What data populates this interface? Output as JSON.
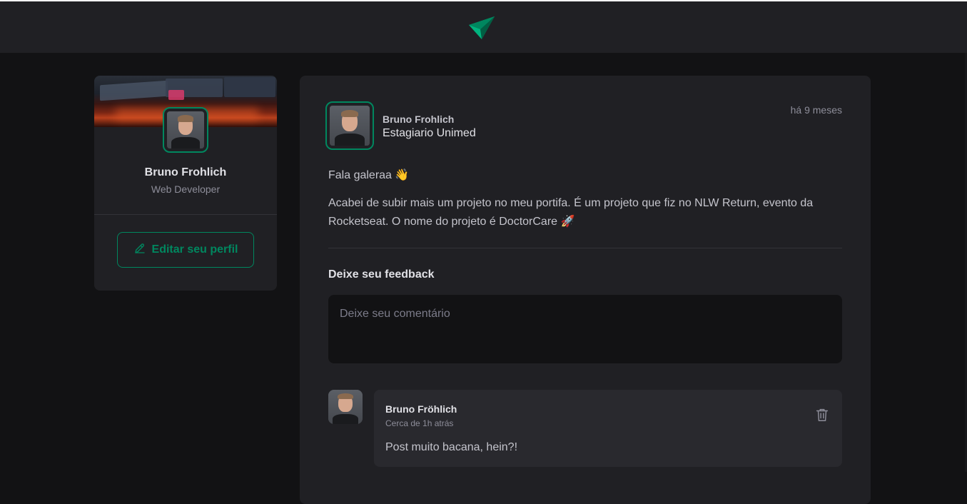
{
  "header": {
    "logo_icon": "paper-plane-logo-icon",
    "accent_color": "#00875f"
  },
  "sidebar": {
    "cover_image": "desk-setup-cover-image",
    "profile": {
      "name": "Bruno Frohlich",
      "role": "Web Developer"
    },
    "edit_button": {
      "label": "Editar seu perfil",
      "icon": "pencil-icon"
    }
  },
  "post": {
    "author": {
      "name": "Bruno Frohlich",
      "role": "Estagiario Unimed"
    },
    "published": "há 9 meses",
    "content": {
      "greeting": "Fala galeraa 👋",
      "body": "Acabei de subir mais um projeto no meu portifa. É um projeto que fiz no NLW Return, evento da Rocketseat. O nome do projeto é DoctorCare 🚀"
    },
    "feedback": {
      "title": "Deixe seu feedback",
      "placeholder": "Deixe seu comentário",
      "value": ""
    },
    "comments": [
      {
        "author": "Bruno Fröhlich",
        "time": "Cerca de 1h atrás",
        "text": "Post muito bacana, hein?!",
        "delete_icon": "trash-icon"
      }
    ]
  }
}
